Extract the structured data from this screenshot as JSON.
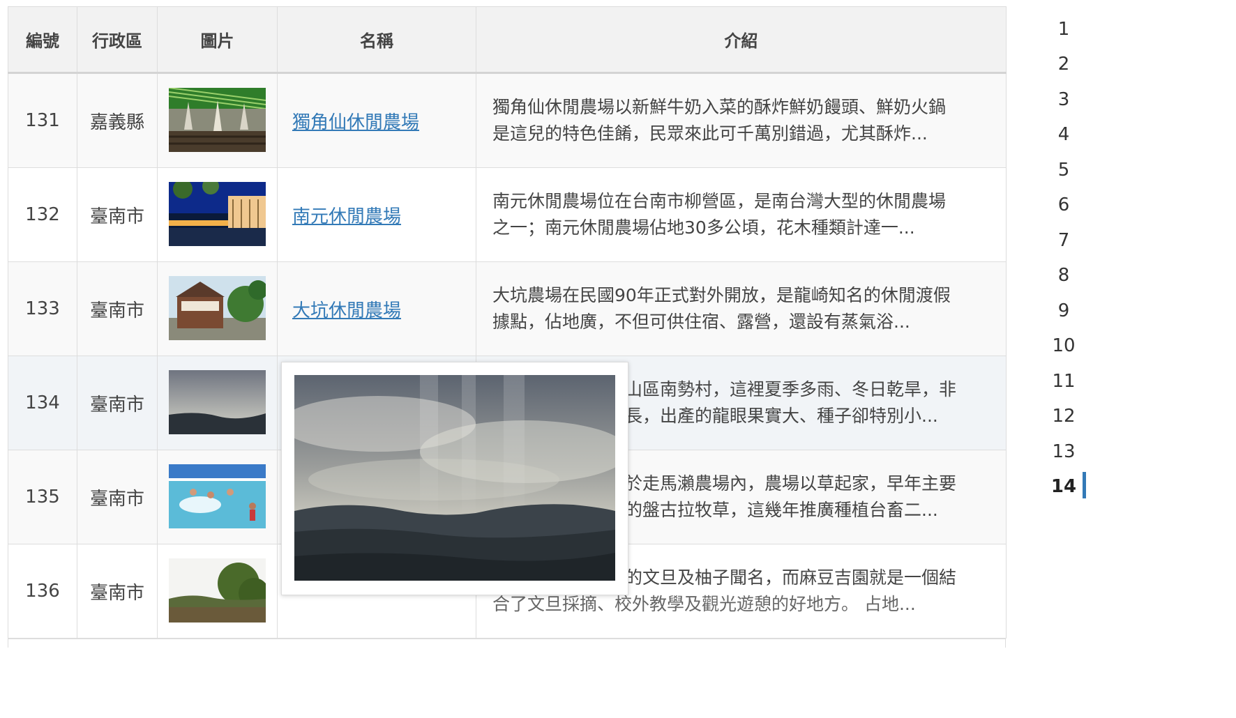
{
  "table": {
    "headers": [
      "編號",
      "行政區",
      "圖片",
      "名稱",
      "介紹"
    ],
    "rows": [
      {
        "id": "131",
        "area": "嘉義縣",
        "name": "獨角仙休閒農場",
        "intro1": "獨角仙休閒農場以新鮮牛奶入菜的酥炸鮮奶饅頭、鮮奶火鍋",
        "intro2": "是這兒的特色佳餚，民眾來此可千萬別錯過，尤其酥炸..."
      },
      {
        "id": "132",
        "area": "臺南市",
        "name": "南元休閒農場",
        "intro1": "南元休閒農場位在台南市柳營區，是南台灣大型的休閒農場",
        "intro2": "之一；南元休閒農場佔地30多公頃，花木種類計達一..."
      },
      {
        "id": "133",
        "area": "臺南市",
        "name": "大坑休閒農場",
        "intro1": "大坑農場在民國90年正式對外開放，是龍崎知名的休閒渡假",
        "intro2": "據點，佔地廣，不但可供住宿、露營，還設有蒸氣浴..."
      },
      {
        "id": "134",
        "area": "臺南市",
        "name": "",
        "intro1": "山區南勢村，這裡夏季多雨、冬日乾旱，非",
        "intro2": "長，出產的龍眼果實大、種子卻特別小..."
      },
      {
        "id": "135",
        "area": "臺南市",
        "name": "",
        "intro1": "於走馬瀨農場內，農場以草起家，早年主要",
        "intro2": "的盤古拉牧草，這幾年推廣種植台畜二..."
      },
      {
        "id": "136",
        "area": "臺南市",
        "name": "",
        "intro1": "的文旦及柚子聞名，而麻豆吉園就是一個結",
        "intro2": "合了文旦採摘、校外教學及觀光遊憩的好地方。 占地..."
      }
    ]
  },
  "pager": {
    "pages": [
      "1",
      "2",
      "3",
      "4",
      "5",
      "6",
      "7",
      "8",
      "9",
      "10",
      "11",
      "12",
      "13",
      "14"
    ],
    "active": "14"
  },
  "colors": {
    "link": "#337ab7",
    "header_bg": "#f2f2f2",
    "border": "#dddddd",
    "active_indicator": "#337ab7"
  }
}
